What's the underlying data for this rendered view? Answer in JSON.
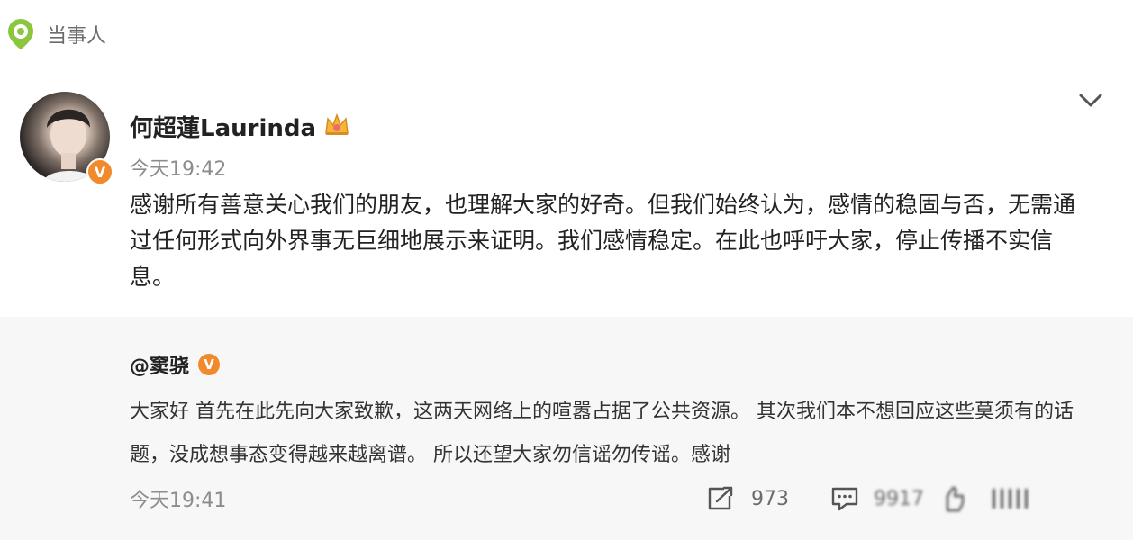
{
  "topic": {
    "label": "当事人"
  },
  "post": {
    "author": "何超蓮Laurinda",
    "time": "今天19:42",
    "verified_badge": "V",
    "text": "感谢所有善意关心我们的朋友，也理解大家的好奇。但我们始终认为，感情的稳固与否，无需通过任何形式向外界事无巨细地展示来证明。我们感情稳定。在此也呼吁大家，停止传播不实信息。"
  },
  "repost": {
    "author": "@窦骁",
    "verified_badge": "V",
    "text": "大家好 首先在此先向大家致歉，这两天网络上的喧嚣占据了公共资源。 其次我们本不想回应这些莫须有的话题，没成想事态变得越来越离谱。 所以还望大家勿信谣勿传谣。感谢",
    "time": "今天19:41",
    "repost_count": "973",
    "comment_count": "9917"
  },
  "icons": {
    "topic": "location-pin-icon",
    "crown": "crown-icon",
    "more": "chevron-down-icon",
    "repost": "repost-icon",
    "comment": "comment-icon",
    "like": "like-icon"
  },
  "colors": {
    "accent": "#f08a2c",
    "topic_green": "#8cc63f",
    "repost_bg": "#f7f7f7"
  }
}
